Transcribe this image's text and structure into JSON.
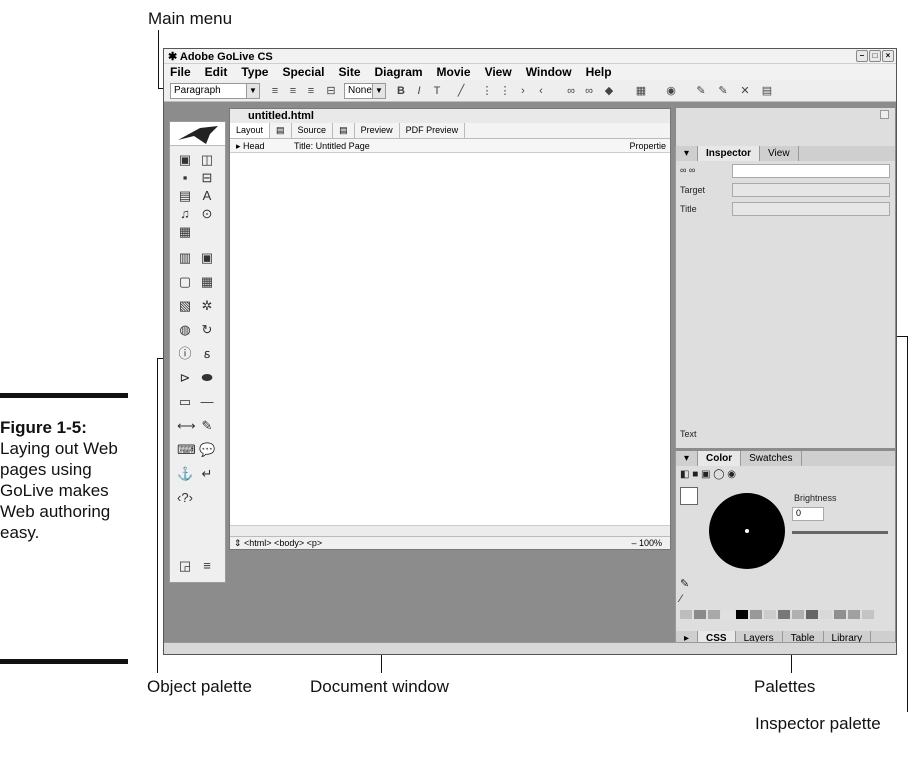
{
  "callouts": {
    "main_menu": "Main menu",
    "object_palette": "Object palette",
    "document_window": "Document window",
    "palettes": "Palettes",
    "inspector_palette": "Inspector palette"
  },
  "caption": {
    "figure": "Figure 1-5:",
    "text": "Laying out Web pages using GoLive makes Web authoring easy."
  },
  "app": {
    "title": "Adobe GoLive CS",
    "menu": [
      "File",
      "Edit",
      "Type",
      "Special",
      "Site",
      "Diagram",
      "Movie",
      "View",
      "Window",
      "Help"
    ],
    "toolbar": {
      "paragraph_select": "Paragraph",
      "none_select": "None"
    }
  },
  "document": {
    "title": "untitled.html",
    "tabs": [
      "Layout",
      "Source",
      "Preview",
      "PDF Preview"
    ],
    "head_label": "Head",
    "page_title": "Title:  Untitled Page",
    "properties": "Propertie",
    "status_path": "<html> <body> <p>",
    "zoom": "100%"
  },
  "inspector": {
    "tabs": [
      "Inspector",
      "View"
    ],
    "target_label": "Target",
    "title_label": "Title",
    "text_label": "Text"
  },
  "color_palette": {
    "tabs": [
      "Color",
      "Swatches"
    ],
    "brightness_label": "Brightness",
    "brightness_value": "0"
  },
  "bottom_tabs": [
    "CSS",
    "Layers",
    "Table",
    "Library"
  ]
}
